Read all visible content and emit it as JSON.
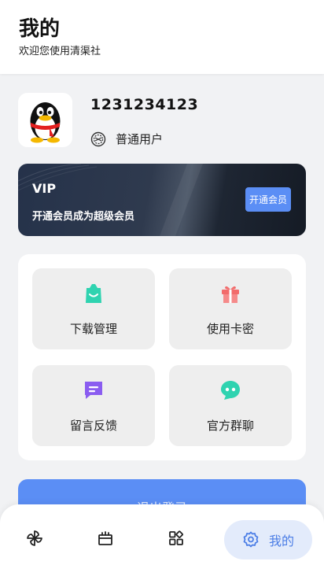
{
  "header": {
    "title": "我的",
    "subtitle": "欢迎您使用清渠社"
  },
  "profile": {
    "username": "1231234123",
    "role": "普通用户",
    "avatar_icon": "qq-penguin-icon",
    "role_icon": "badge-icon"
  },
  "vip": {
    "title": "VIP",
    "description": "开通会员成为超级会员",
    "button_label": "开通会员"
  },
  "menu": {
    "items": [
      {
        "label": "下载管理",
        "icon": "shopping-bag-icon",
        "color": "#2fd3b0"
      },
      {
        "label": "使用卡密",
        "icon": "gift-icon",
        "color": "#f26b6b"
      },
      {
        "label": "留言反馈",
        "icon": "message-icon",
        "color": "#8a5cf0"
      },
      {
        "label": "官方群聊",
        "icon": "chat-bot-icon",
        "color": "#2fd3b0"
      }
    ]
  },
  "logout": {
    "label": "退出登录"
  },
  "tabbar": {
    "tabs": [
      {
        "icon": "pinwheel-icon"
      },
      {
        "icon": "store-icon"
      },
      {
        "icon": "apps-icon"
      },
      {
        "icon": "gear-icon",
        "label": "我的",
        "active": true
      }
    ]
  },
  "colors": {
    "accent": "#5b8ef5",
    "active_tab_bg": "#e3ebfb"
  }
}
